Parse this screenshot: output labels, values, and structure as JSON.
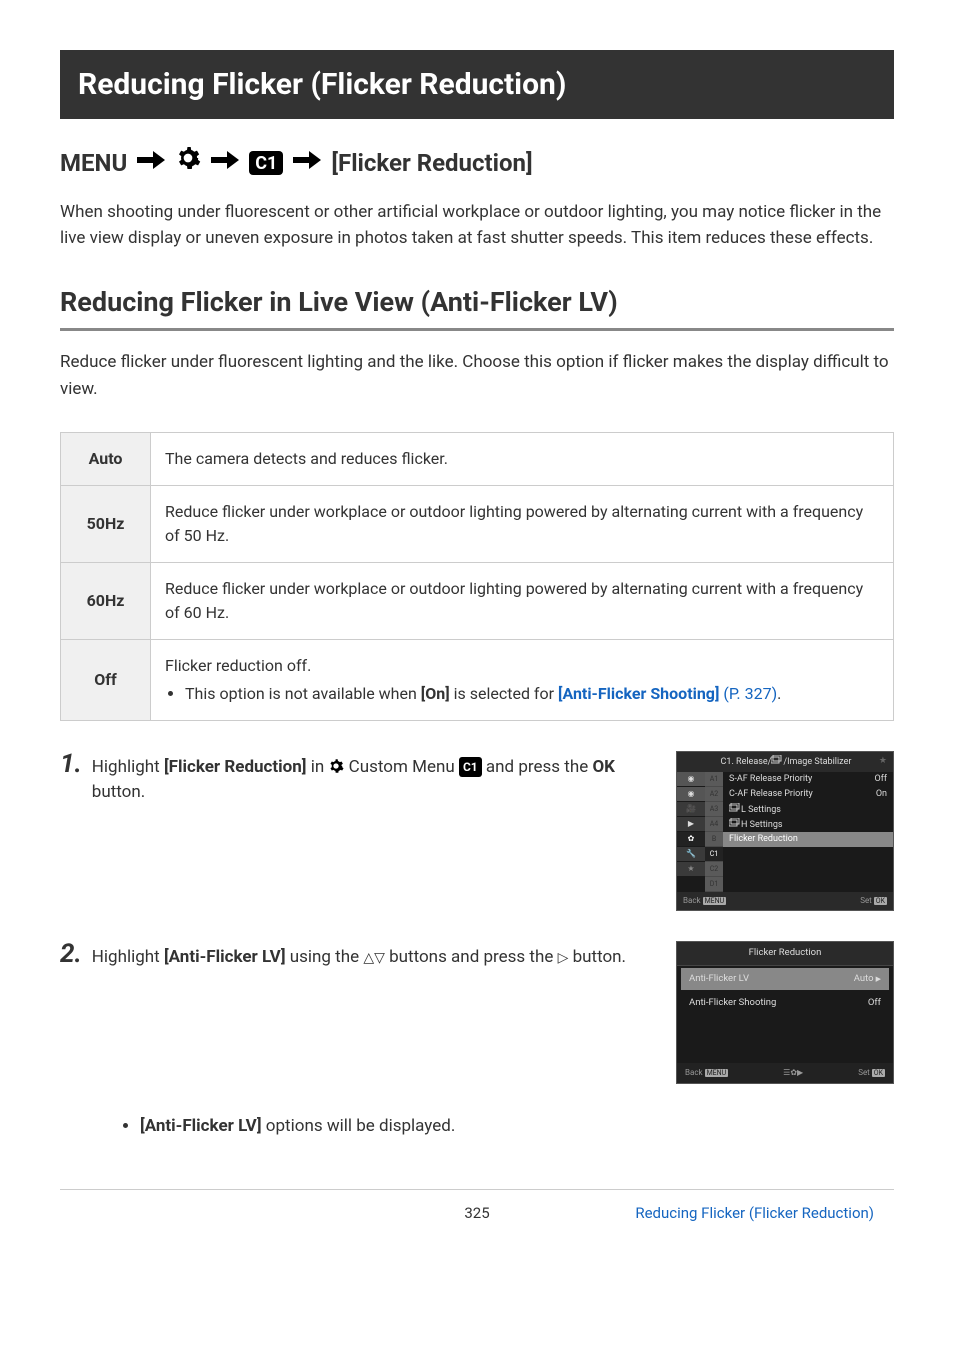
{
  "title": "Reducing Flicker (Flicker Reduction)",
  "menu_path": {
    "menu": "MENU",
    "target": "[Flicker Reduction]"
  },
  "intro": "When shooting under fluorescent or other artificial workplace or outdoor lighting, you may notice flicker in the live view display or uneven exposure in photos taken at fast shutter speeds. This item reduces these effects.",
  "section_heading": "Reducing Flicker in Live View (Anti-Flicker LV)",
  "section_intro": "Reduce flicker under fluorescent lighting and the like. Choose this option if flicker makes the display difficult to view.",
  "options": [
    {
      "label": "Auto",
      "desc": "The camera detects and reduces flicker."
    },
    {
      "label": "50Hz",
      "desc": "Reduce flicker under workplace or outdoor lighting powered by alternating current with a frequency of 50 Hz."
    },
    {
      "label": "60Hz",
      "desc": "Reduce flicker under workplace or outdoor lighting powered by alternating current with a frequency of 60 Hz."
    },
    {
      "label": "Off",
      "desc": "Flicker reduction off.",
      "note_pre": "This option is not available when ",
      "note_bold1": "[On]",
      "note_mid": " is selected for ",
      "note_link": "[Anti-Flicker Shooting]",
      "note_ref": " (P. 327)",
      "note_post": "."
    }
  ],
  "steps": {
    "s1": {
      "num": "1.",
      "t1": "Highlight ",
      "b1": "[Flicker Reduction]",
      "t2": " in ",
      "t3": " Custom Menu ",
      "c1": "C1",
      "t4": " and press the ",
      "b2": "OK",
      "t5": " button."
    },
    "s2": {
      "num": "2.",
      "t1": "Highlight ",
      "b1": "[Anti-Flicker LV]",
      "t2": " using the ",
      "tri": "△▽",
      "t3": " buttons and press the ",
      "tri2": "▷",
      "t4": " button."
    },
    "bullet": "[Anti-Flicker LV]",
    "bullet_after": " options will be displayed."
  },
  "shot1": {
    "title": "C1. Release/",
    "title2": "/Image Stabilizer",
    "tabs_top": [
      "📷",
      "📷",
      "🎥",
      "▶"
    ],
    "gear": "✿",
    "subtabs": [
      "A1",
      "A2",
      "A3",
      "A4",
      "B",
      "C1",
      "C2",
      "D1"
    ],
    "rows": [
      {
        "l": "S-AF Release Priority",
        "r": "Off"
      },
      {
        "l": "C-AF Release Priority",
        "r": "On"
      },
      {
        "l": "L Settings",
        "r": "",
        "seq": true
      },
      {
        "l": "H Settings",
        "r": "",
        "seq": true
      },
      {
        "l": "Flicker Reduction",
        "r": "",
        "sel": true
      }
    ],
    "back": "Back",
    "set": "Set"
  },
  "shot2": {
    "title": "Flicker Reduction",
    "rows": [
      {
        "l": "Anti-Flicker LV",
        "r": "Auto",
        "sel": true,
        "arrow": true
      },
      {
        "l": "Anti-Flicker Shooting",
        "r": "Off"
      }
    ],
    "back": "Back",
    "mid": "",
    "set": "Set"
  },
  "footer": {
    "page": "325",
    "breadcrumb": "Reducing Flicker (Flicker Reduction)"
  }
}
